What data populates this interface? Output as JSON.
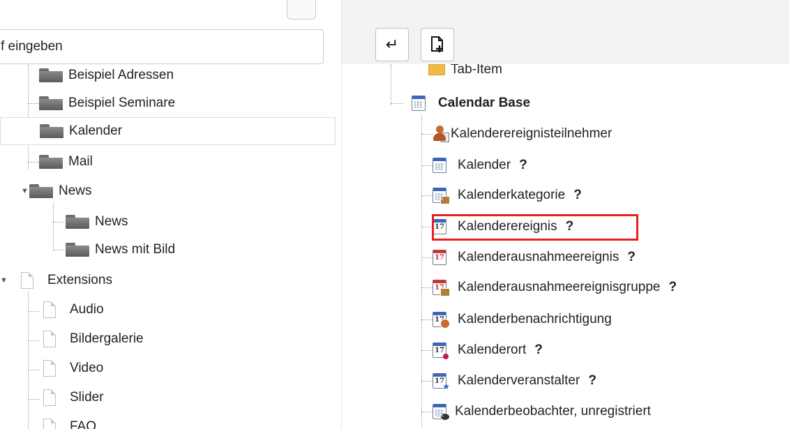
{
  "search": {
    "value": "f eingeben"
  },
  "toolbar": {
    "enter_icon": "↵",
    "new_page_icon": "new-page-icon"
  },
  "left_tree": {
    "items": [
      {
        "label": "Beispiel Adressen",
        "icon": "folder-icon"
      },
      {
        "label": "Beispiel Seminare",
        "icon": "folder-icon"
      },
      {
        "label": "Kalender",
        "icon": "folder-icon",
        "selected": true
      },
      {
        "label": "Mail",
        "icon": "folder-icon"
      },
      {
        "label": "News",
        "icon": "folder-icon",
        "expanded": true
      },
      {
        "label": "News",
        "icon": "folder-icon"
      },
      {
        "label": "News mit Bild",
        "icon": "folder-icon"
      },
      {
        "label": "Extensions",
        "icon": "page-icon",
        "expanded": true
      },
      {
        "label": "Audio",
        "icon": "page-icon"
      },
      {
        "label": "Bildergalerie",
        "icon": "page-icon"
      },
      {
        "label": "Video",
        "icon": "page-icon"
      },
      {
        "label": "Slider",
        "icon": "page-icon"
      },
      {
        "label": "FAQ",
        "icon": "page-icon"
      }
    ]
  },
  "right_tree": {
    "partial_item": {
      "label": "Tab-Item",
      "icon": "tab-item-icon"
    },
    "group": {
      "label": "Calendar Base",
      "icon": "calendar-icon"
    },
    "help_marker": "?",
    "calendar_number": "17",
    "items": [
      {
        "label": "Kalenderereignisteilnehmer",
        "icon": "participant-icon",
        "help": false
      },
      {
        "label": "Kalender",
        "icon": "calendar-icon",
        "help": true
      },
      {
        "label": "Kalenderkategorie",
        "icon": "calendar-category-icon",
        "help": true
      },
      {
        "label": "Kalenderereignis",
        "icon": "calendar-event-icon",
        "help": true,
        "highlighted": true
      },
      {
        "label": "Kalenderausnahmeereignis",
        "icon": "calendar-exception-icon",
        "help": true
      },
      {
        "label": "Kalenderausnahmeereignisgruppe",
        "icon": "calendar-exception-group-icon",
        "help": true
      },
      {
        "label": "Kalenderbenachrichtigung",
        "icon": "calendar-notification-icon",
        "help": false
      },
      {
        "label": "Kalenderort",
        "icon": "calendar-location-icon",
        "help": true
      },
      {
        "label": "Kalenderveranstalter",
        "icon": "calendar-organizer-icon",
        "help": true
      },
      {
        "label": "Kalenderbeobachter, unregistriert",
        "icon": "calendar-observer-icon",
        "help": false
      }
    ]
  },
  "colors": {
    "highlight": "#e8201f",
    "calendar_header": "#3c66b8"
  }
}
